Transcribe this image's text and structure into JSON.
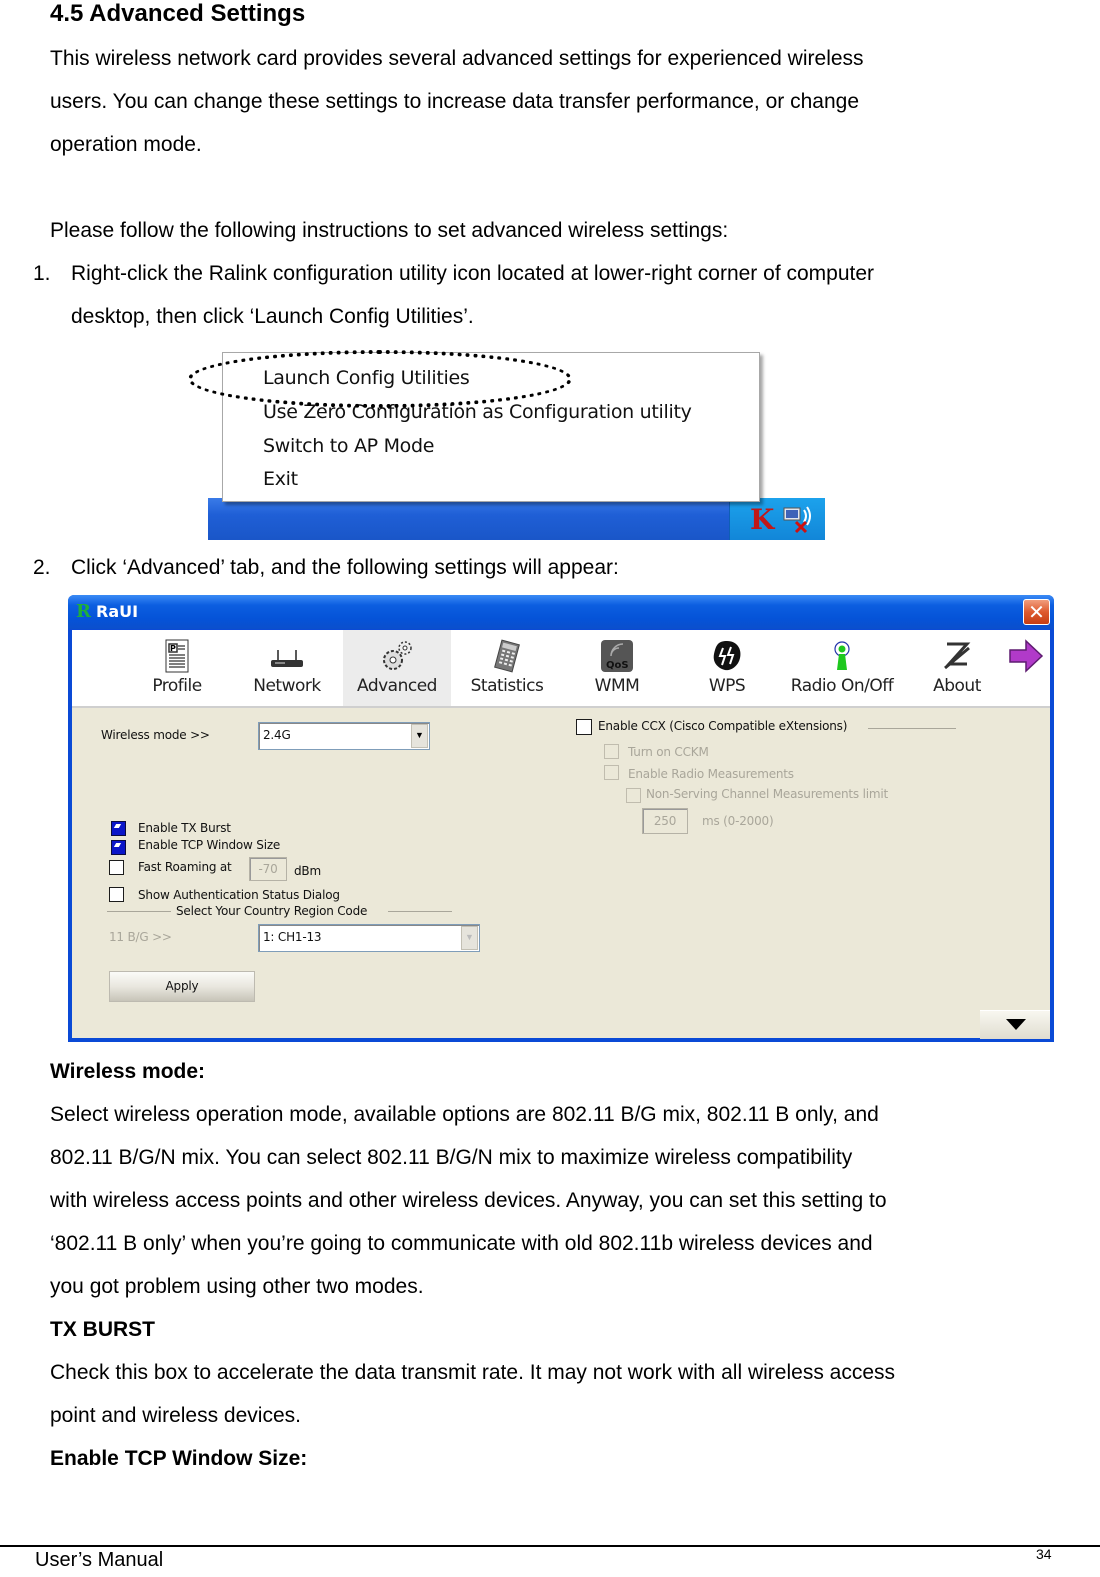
{
  "section": {
    "title": "4.5 Advanced Settings",
    "intro_lines": [
      "This wireless network card provides several advanced settings for experienced wireless",
      "users. You can change these settings to increase data transfer performance, or change",
      "operation mode."
    ],
    "instructions_lead": "Please follow the following instructions to set advanced wireless settings:",
    "steps": [
      {
        "number": "1.",
        "lines": [
          "Right-click the Ralink configuration utility icon located at lower-right corner of computer",
          "desktop, then click ‘Launch Config Utilities’."
        ]
      },
      {
        "number": "2.",
        "lines": [
          "Click ‘Advanced’ tab, and the following settings will appear:"
        ]
      }
    ]
  },
  "context_menu": {
    "items": [
      "Launch Config Utilities",
      "Use Zero Configuration as Configuration utility",
      "Switch to AP Mode",
      "Exit"
    ],
    "highlighted_item": "Launch Config Utilities",
    "tray_icons": [
      "ralink-utility-icon",
      "wireless-network-disconnected-icon"
    ]
  },
  "raui": {
    "title": "RaUI",
    "logo": "R",
    "close_label": "✕",
    "toolbar": [
      {
        "label": "Profile",
        "icon": "profile-icon",
        "active": false
      },
      {
        "label": "Network",
        "icon": "network-icon",
        "active": false
      },
      {
        "label": "Advanced",
        "icon": "gears-icon",
        "active": true
      },
      {
        "label": "Statistics",
        "icon": "calculator-icon",
        "active": false
      },
      {
        "label": "WMM",
        "icon": "qos-icon",
        "active": false
      },
      {
        "label": "WPS",
        "icon": "wps-icon",
        "active": false
      },
      {
        "label": "Radio On/Off",
        "icon": "radio-antenna-icon",
        "active": false
      },
      {
        "label": "About",
        "icon": "about-icon",
        "active": false
      }
    ],
    "next_arrow": "➡",
    "wireless_mode": {
      "label": "Wireless mode >>",
      "value": "2.4G"
    },
    "options": {
      "tx_burst": {
        "label": "Enable TX Burst",
        "checked": true
      },
      "tcp_window": {
        "label": "Enable TCP Window Size",
        "checked": true
      },
      "fast_roaming": {
        "label": "Fast Roaming at",
        "checked": false,
        "value": "-70",
        "unit": "dBm"
      },
      "auth_dialog": {
        "label": "Show Authentication Status Dialog",
        "checked": false
      }
    },
    "country_region": {
      "group_label": "Select Your Country Region Code",
      "band_label": "11 B/G >>",
      "value": "1: CH1-13"
    },
    "ccx": {
      "label": "Enable CCX (Cisco Compatible eXtensions)",
      "checked": false,
      "cckm": {
        "label": "Turn on CCKM",
        "checked": false
      },
      "radio_measurements": {
        "label": "Enable Radio Measurements",
        "checked": false
      },
      "non_serving": {
        "label": "Non-Serving Channel Measurements limit",
        "checked": false
      },
      "limit_value": "250",
      "limit_unit": "ms (0-2000)"
    },
    "apply_label": "Apply"
  },
  "body_sections": [
    {
      "heading": "Wireless mode:",
      "lines": [
        "Select wireless operation mode, available options are 802.11 B/G mix, 802.11 B only, and",
        "802.11 B/G/N mix. You can select 802.11 B/G/N mix to maximize wireless compatibility",
        "with wireless access points and other wireless devices. Anyway, you can set this setting to",
        "‘802.11 B only’ when you’re going to communicate with old 802.11b wireless devices and",
        "you got problem using other two modes."
      ]
    },
    {
      "heading": "TX BURST",
      "lines": [
        "Check this box to accelerate the data transmit rate. It may not work with all wireless access",
        "point and wireless devices."
      ]
    },
    {
      "heading": "Enable TCP Window Size:",
      "lines": []
    }
  ],
  "footer": {
    "left": "User’s Manual",
    "page_number": "34"
  }
}
